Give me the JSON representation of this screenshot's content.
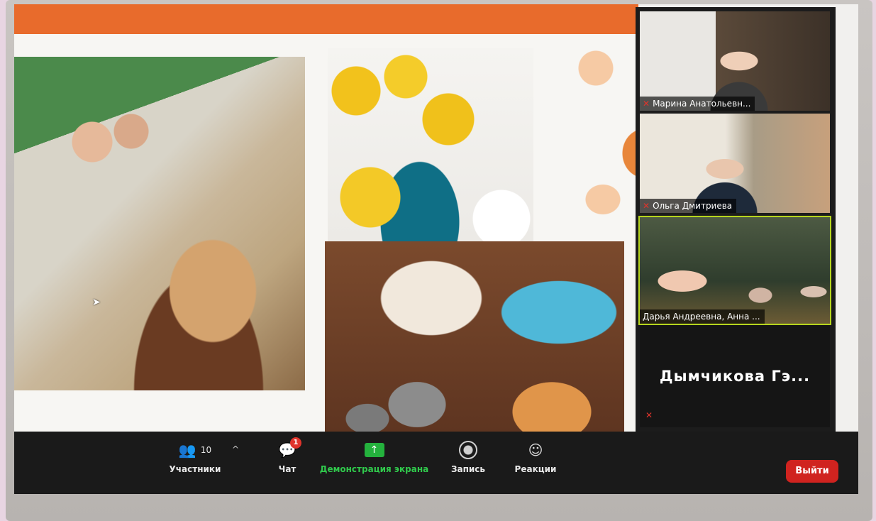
{
  "participants_panel": {
    "tiles": [
      {
        "name": "Марина Анатольевн..."
      },
      {
        "name": "Ольга Дмитриева"
      },
      {
        "name": "Дарья Андреевна, Анна ..."
      }
    ],
    "audio_only_name": "Дымчикова Гэ..."
  },
  "toolbar": {
    "participants": {
      "label": "Участники",
      "count": "10"
    },
    "chat": {
      "label": "Чат",
      "badge": "1"
    },
    "share": {
      "label": "Демонстрация экрана"
    },
    "record": {
      "label": "Запись"
    },
    "reactions": {
      "label": "Реакции"
    },
    "leave": {
      "label": "Выйти"
    }
  },
  "colors": {
    "share_green": "#30c94c",
    "leave_red": "#d0231f",
    "active_speaker": "#b6d51e",
    "muted_red": "#e0342c"
  }
}
